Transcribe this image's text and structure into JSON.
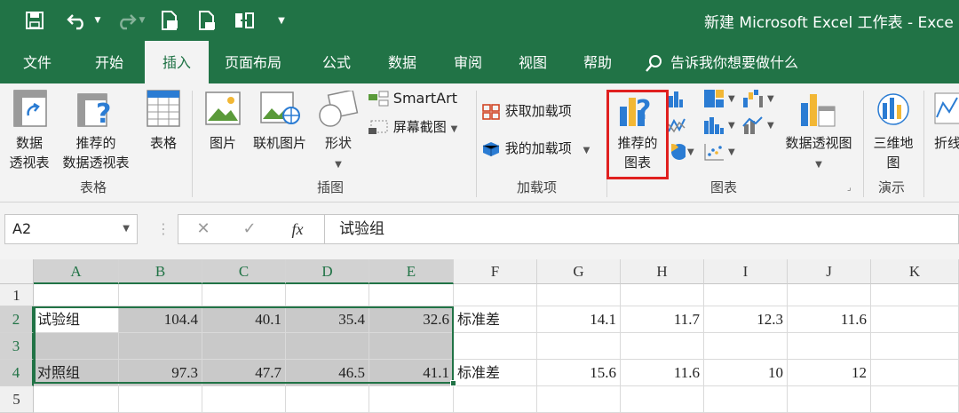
{
  "window": {
    "title": "新建 Microsoft Excel 工作表 - Exce"
  },
  "quick_access": {
    "icons": [
      "save-icon",
      "undo-icon",
      "redo-icon",
      "print-preview-icon",
      "print-icon",
      "touch-mode-icon",
      "customize-icon"
    ]
  },
  "tabs": [
    {
      "label": "文件",
      "active": false
    },
    {
      "label": "开始",
      "active": false
    },
    {
      "label": "插入",
      "active": true
    },
    {
      "label": "页面布局",
      "active": false
    },
    {
      "label": "公式",
      "active": false
    },
    {
      "label": "数据",
      "active": false
    },
    {
      "label": "审阅",
      "active": false
    },
    {
      "label": "视图",
      "active": false
    },
    {
      "label": "帮助",
      "active": false
    }
  ],
  "tell_me": "告诉我你想要做什么",
  "ribbon": {
    "tables": {
      "group": "表格",
      "pivot": [
        "数据",
        "透视表"
      ],
      "recommended_pivot": [
        "推荐的",
        "数据透视表"
      ],
      "table": "表格"
    },
    "illustrations": {
      "group": "插图",
      "pictures": "图片",
      "online_pictures": "联机图片",
      "shapes": "形状",
      "smartart": "SmartArt",
      "screenshot": "屏幕截图"
    },
    "addins": {
      "group": "加载项",
      "get_addins": "获取加载项",
      "my_addins": "我的加载项"
    },
    "charts": {
      "group": "图表",
      "recommended": [
        "推荐的",
        "图表"
      ],
      "pivot_chart": "数据透视图"
    },
    "tours": {
      "group": "演示",
      "map3d": [
        "三维地",
        "图"
      ]
    },
    "sparklines": {
      "line": "折线"
    }
  },
  "name_box": "A2",
  "formula": "试验组",
  "fx_label": "fx",
  "columns": [
    "A",
    "B",
    "C",
    "D",
    "E",
    "F",
    "G",
    "H",
    "I",
    "J",
    "K"
  ],
  "rows": [
    "1",
    "2",
    "3",
    "4",
    "5"
  ],
  "cells": {
    "A2": "试验组",
    "B2": "104.4",
    "C2": "40.1",
    "D2": "35.4",
    "E2": "32.6",
    "F2": "标准差",
    "G2": "14.1",
    "H2": "11.7",
    "I2": "12.3",
    "J2": "11.6",
    "A4": "对照组",
    "B4": "97.3",
    "C4": "47.7",
    "D4": "46.5",
    "E4": "41.1",
    "F4": "标准差",
    "G4": "15.6",
    "H4": "11.6",
    "I4": "10",
    "J4": "12"
  },
  "colors": {
    "brand": "#217346",
    "highlight_box": "#e0201f",
    "selection_fill": "#c9c9c9"
  }
}
